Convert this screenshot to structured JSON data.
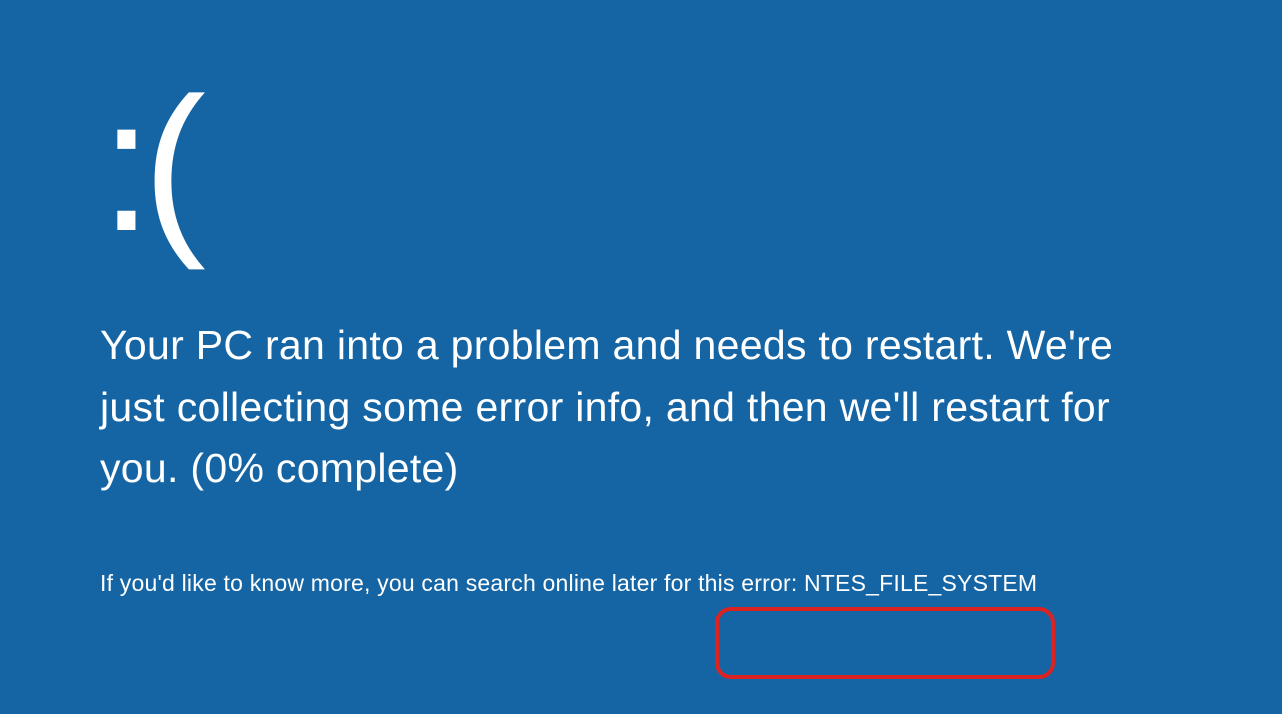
{
  "bsod": {
    "emoticon": ":(",
    "main_message": "Your PC ran into a problem and needs to restart. We're just collecting some error info, and then we'll restart for you. (0% complete)",
    "footer_prefix": "If you'd like to know more, you can search online later for this error: ",
    "error_code": "NTES_FILE_SYSTEM"
  },
  "colors": {
    "background": "#1565A5",
    "text": "#ffffff",
    "highlight": "#DD2222"
  }
}
